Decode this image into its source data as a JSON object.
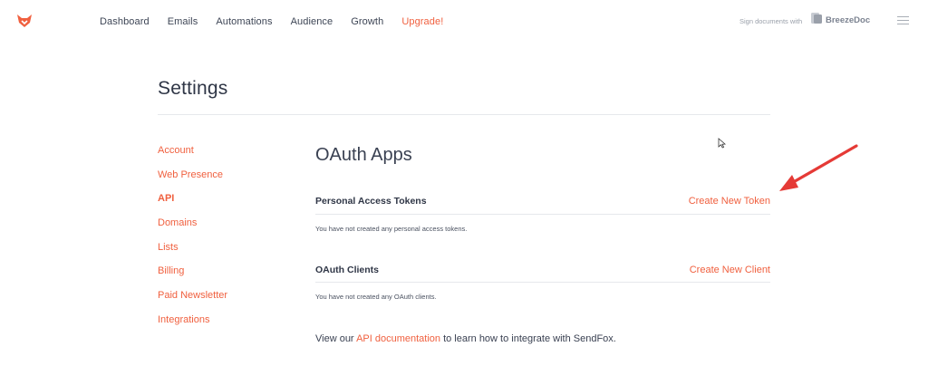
{
  "nav": {
    "items": [
      {
        "label": "Dashboard"
      },
      {
        "label": "Emails"
      },
      {
        "label": "Automations"
      },
      {
        "label": "Audience"
      },
      {
        "label": "Growth"
      },
      {
        "label": "Upgrade!"
      }
    ]
  },
  "header": {
    "sign_text": "Sign documents with",
    "breezedoc_label": "BreezeDoc"
  },
  "page": {
    "title": "Settings"
  },
  "sidebar": {
    "items": [
      {
        "label": "Account"
      },
      {
        "label": "Web Presence"
      },
      {
        "label": "API"
      },
      {
        "label": "Domains"
      },
      {
        "label": "Lists"
      },
      {
        "label": "Billing"
      },
      {
        "label": "Paid Newsletter"
      },
      {
        "label": "Integrations"
      }
    ],
    "active": "API"
  },
  "main": {
    "heading": "OAuth Apps",
    "tokens": {
      "label": "Personal Access Tokens",
      "action": "Create New Token",
      "empty": "You have not created any personal access tokens."
    },
    "clients": {
      "label": "OAuth Clients",
      "action": "Create New Client",
      "empty": "You have not created any OAuth clients."
    },
    "footer": {
      "prefix": "View our ",
      "link": "API documentation",
      "suffix": " to learn how to integrate with SendFox."
    }
  },
  "colors": {
    "accent": "#f0603f",
    "annotation_arrow": "#e53a36"
  },
  "icons": {
    "logo": "sendfox-logo-icon",
    "breezedoc": "breezedoc-logo-icon",
    "menu": "hamburger-menu-icon",
    "cursor": "mouse-pointer-icon",
    "annotation": "red-arrow-icon"
  }
}
